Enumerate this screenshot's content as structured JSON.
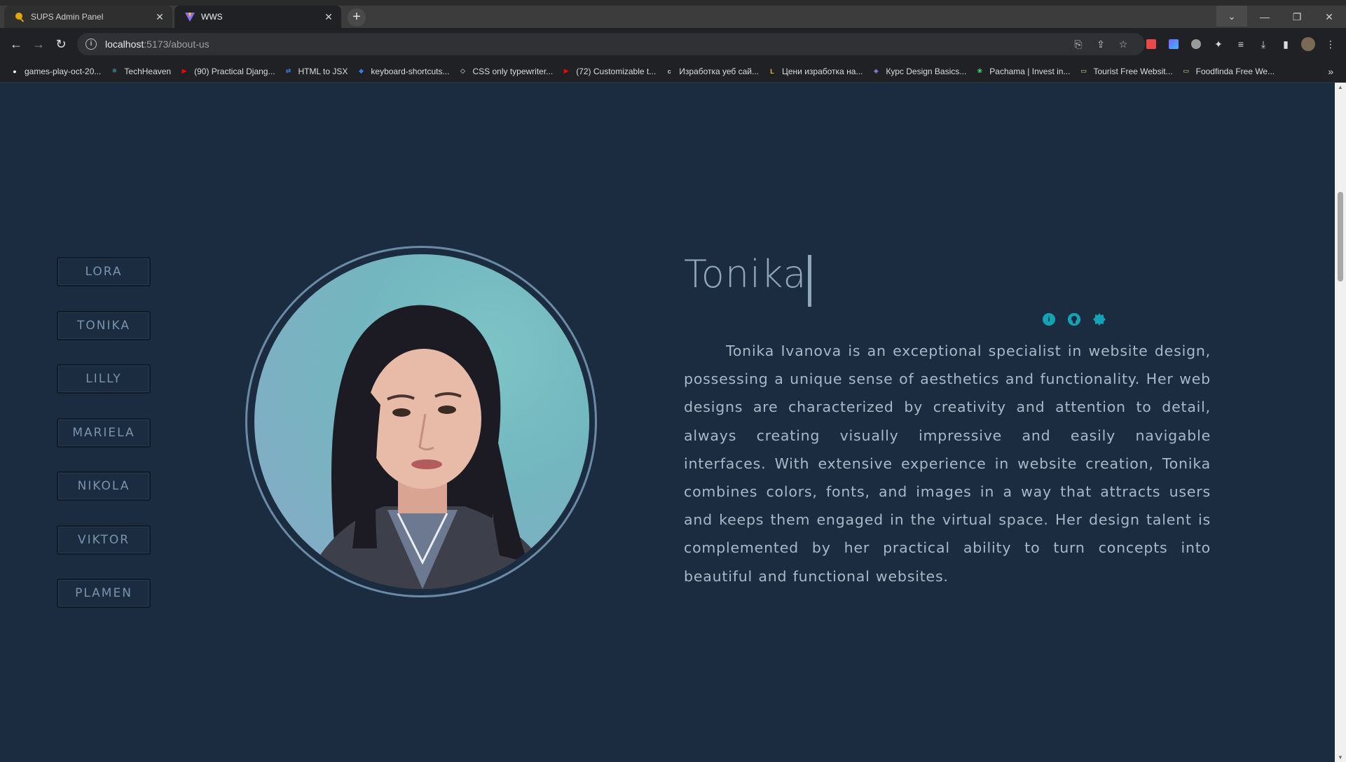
{
  "browser": {
    "tabs": [
      {
        "title": "SUPS Admin Panel",
        "active": false
      },
      {
        "title": "WWS",
        "active": true
      }
    ],
    "url_host": "localhost",
    "url_path": ":5173/about-us",
    "bookmarks": [
      {
        "label": "games-play-oct-20...",
        "icon": "github-icon",
        "color": "#ffffff"
      },
      {
        "label": "TechHeaven",
        "icon": "react-icon",
        "color": "#61dafb"
      },
      {
        "label": "(90) Practical Djang...",
        "icon": "youtube-icon",
        "color": "#ff0000"
      },
      {
        "label": "HTML to JSX",
        "icon": "transform-icon",
        "color": "#3b82f6"
      },
      {
        "label": "keyboard-shortcuts...",
        "icon": "vscode-icon",
        "color": "#2f80ed"
      },
      {
        "label": "CSS only typewriter...",
        "icon": "codepen-icon",
        "color": "#ffffff"
      },
      {
        "label": "(72) Customizable t...",
        "icon": "youtube-icon",
        "color": "#ff0000"
      },
      {
        "label": "Изработка уеб сай...",
        "icon": "cli-icon",
        "color": "#cccccc"
      },
      {
        "label": "Цени изработка на...",
        "icon": "l-icon",
        "color": "#f5c518"
      },
      {
        "label": "Курс Design Basics...",
        "icon": "softuni-icon",
        "color": "#a78bfa"
      },
      {
        "label": "Pachama | Invest in...",
        "icon": "leaf-icon",
        "color": "#4ade80"
      },
      {
        "label": "Tourist Free Websit...",
        "icon": "image-icon",
        "color": "#d9d9a0"
      },
      {
        "label": "Foodfinda Free We...",
        "icon": "image-icon",
        "color": "#d9d9a0"
      }
    ]
  },
  "team": {
    "members": [
      "LORA",
      "TONIKA",
      "LILLY",
      "MARIELA",
      "NIKOLA",
      "VIKTOR",
      "PLAMEN"
    ],
    "selected": {
      "name": "Tonika",
      "bio": "Tonika Ivanova is an exceptional specialist in website design, possessing a unique sense of aesthetics and functionality. Her web designs are characterized by creativity and attention to detail, always creating visually impressive and easily navigable interfaces. With extensive experience in website creation, Tonika combines colors, fonts, and images in a way that attracts users and keeps them engaged in the virtual space. Her design talent is complemented by her practical ability to turn concepts into beautiful and functional websites."
    },
    "social_icons": [
      "info-icon",
      "github-icon",
      "badge-icon"
    ]
  },
  "colors": {
    "page_bg": "#1c2c40",
    "accent": "#13a3b4",
    "text": "#a7b8c8"
  }
}
